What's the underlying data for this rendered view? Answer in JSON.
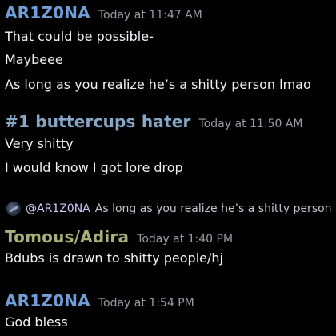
{
  "colors": {
    "background": "#000000",
    "arizona": "#6f9fd8",
    "buttercups": "#86a8c8",
    "tomous": "#a7b077",
    "timestamp": "#9a9ca3",
    "message_text": "#f2f3f5",
    "mention": "#c9cdfb"
  },
  "groups": [
    {
      "username": "AR1Z0NA",
      "timestamp": "Today at 11:47 AM",
      "lines": [
        "That could be possible-",
        "Maybeee",
        "As long as you realize he’s a shitty person lmao"
      ]
    },
    {
      "username": "#1 buttercups hater",
      "timestamp": "Today at 11:50 AM",
      "lines": [
        "Very shitty",
        "I would know I got lore drop"
      ]
    },
    {
      "reply": {
        "avatar_icon": "user-avatar-icon",
        "mention": "@AR1Z0NA",
        "text": "As long as you realize he’s a shitty person lmao"
      },
      "username": "Tomous/Adira",
      "timestamp": "Today at 1:40 PM",
      "lines": [
        "Bdubs is drawn to shitty people/hj"
      ]
    },
    {
      "username": "AR1Z0NA",
      "timestamp": "Today at 1:54 PM",
      "lines": [
        "God bless"
      ]
    }
  ]
}
